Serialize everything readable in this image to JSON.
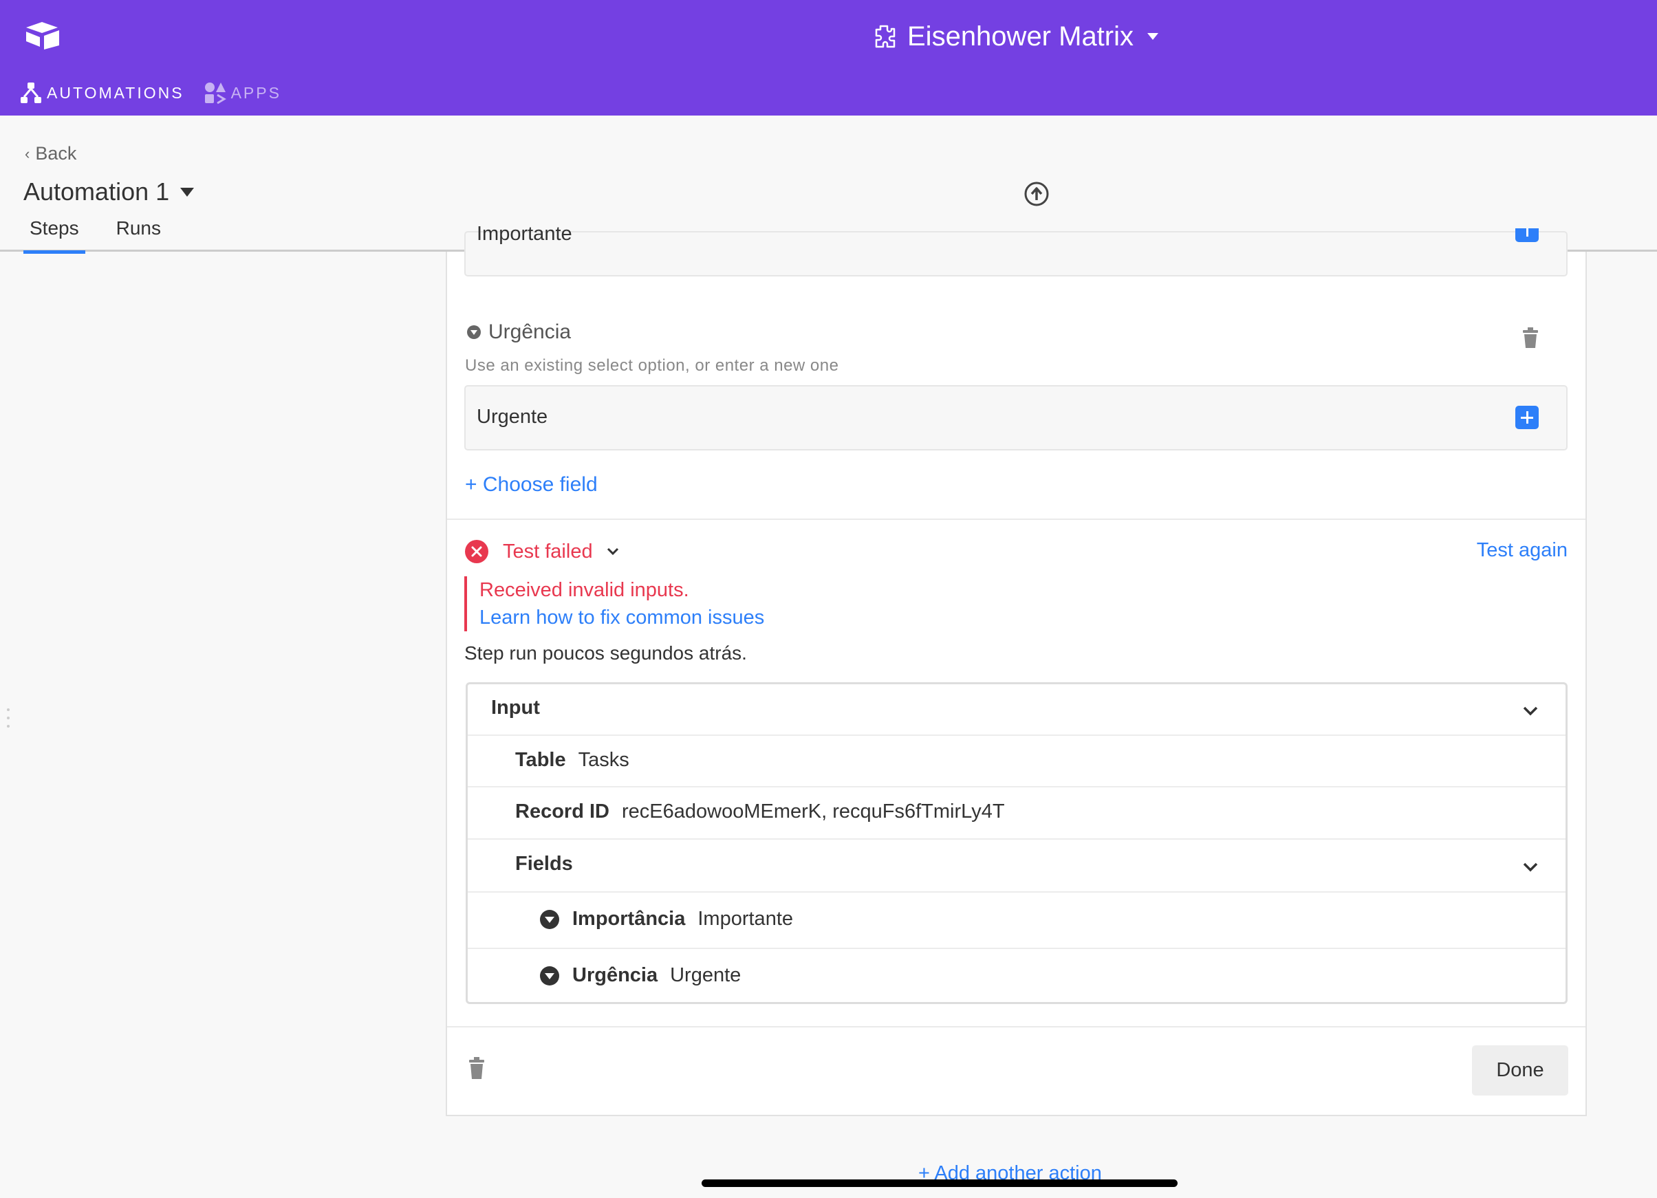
{
  "colors": {
    "header": "#7440e2",
    "accent": "#2d7ff9",
    "error": "#e8384f"
  },
  "header": {
    "base_name": "Eisenhower Matrix",
    "nav_tabs": [
      {
        "label": "AUTOMATIONS",
        "icon": "automations-icon",
        "active": true
      },
      {
        "label": "APPS",
        "icon": "apps-icon",
        "active": false
      }
    ]
  },
  "subheader": {
    "back_label": "Back",
    "automation_name": "Automation 1",
    "tabs": [
      {
        "label": "Steps",
        "active": true
      },
      {
        "label": "Runs",
        "active": false
      }
    ]
  },
  "step": {
    "previous_field_value": "Importante",
    "field": {
      "label": "Urgência",
      "hint": "Use an existing select option, or enter a new one",
      "value": "Urgente"
    },
    "choose_field_label": "+ Choose field",
    "test": {
      "status": "Test failed",
      "again_label": "Test again",
      "error_message": "Received invalid inputs.",
      "help_link": "Learn how to fix common issues",
      "run_time": "Step run poucos segundos atrás."
    },
    "input": {
      "header": "Input",
      "rows": [
        {
          "key": "Table",
          "value": "Tasks"
        },
        {
          "key": "Record ID",
          "value": "recE6adowooMEmerK, recquFs6fTmirLy4T"
        }
      ],
      "fields_header": "Fields",
      "fields": [
        {
          "key": "Importância",
          "value": "Importante"
        },
        {
          "key": "Urgência",
          "value": "Urgente"
        }
      ]
    },
    "done_label": "Done"
  },
  "add_action_label": "+ Add another action"
}
